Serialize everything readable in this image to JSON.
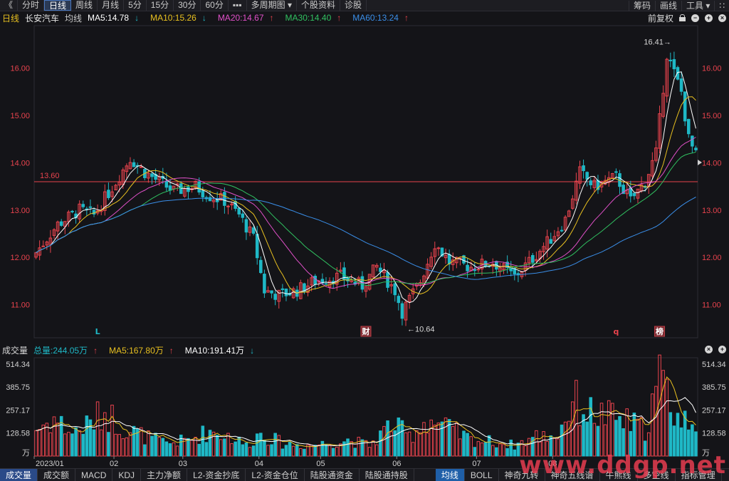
{
  "toolbar": {
    "collapse": "《",
    "items": [
      "分时",
      "日线",
      "周线",
      "月线",
      "5分",
      "15分",
      "30分",
      "60分",
      "▪▪▪",
      "多周期图",
      "▾",
      "个股资料",
      "诊股"
    ],
    "right": [
      "筹码",
      "画线",
      "工具",
      "▾",
      "∷"
    ]
  },
  "info": {
    "period": "日线",
    "stock": "长安汽车",
    "ma_label": "均线",
    "ma5": "MA5:14.78",
    "ma10": "MA10:15.26",
    "ma20": "MA20:14.67",
    "ma30": "MA30:14.40",
    "ma60": "MA60:13.24",
    "adjust": "前复权"
  },
  "volume": {
    "title": "成交量",
    "total": "总量:244.05万",
    "ma5": "MA5:167.80万",
    "ma10": "MA10:191.41万"
  },
  "annotations": {
    "high": "16.41→",
    "low": "←10.64",
    "hline": "13.60",
    "m_L": "L",
    "m_cai": "财",
    "m_q": "q",
    "m_bang": "榜"
  },
  "tabs": [
    "成交量",
    "成交额",
    "MACD",
    "KDJ",
    "主力净额",
    "L2-资金抄底",
    "L2-资金仓位",
    "陆股通资金",
    "陆股通持股",
    "均线",
    "BOLL",
    "神奇九转",
    "神奇五线谱",
    "牛熊线",
    "多空线",
    "指标管理"
  ],
  "watermark": "www.ddgp.net",
  "colors": {
    "up": "#e8434d",
    "down": "#1fb8c6",
    "ma5": "#ffffff",
    "ma10": "#e8c020",
    "ma20": "#e050c8",
    "ma30": "#30c060",
    "ma60": "#3a8ee8"
  },
  "chart_data": {
    "type": "candlestick",
    "price_axis": {
      "ticks": [
        11.0,
        12.0,
        13.0,
        14.0,
        15.0,
        16.0
      ],
      "ylim": [
        10.3,
        16.9
      ]
    },
    "volume_axis": {
      "ticks": [
        "514.34",
        "385.75",
        "257.17",
        "128.58",
        "万"
      ],
      "ylim": [
        0,
        550
      ]
    },
    "x_labels": [
      "2023/01",
      "02",
      "03",
      "04",
      "05",
      "06",
      "07",
      "08"
    ],
    "marked_high": 16.41,
    "marked_low": 10.64,
    "horizontal_line": 13.6,
    "ohlc_knots": [
      [
        0,
        12.1
      ],
      [
        6,
        12.7
      ],
      [
        12,
        13.0
      ],
      [
        16,
        12.9
      ],
      [
        22,
        13.6
      ],
      [
        26,
        14.1
      ],
      [
        30,
        13.8
      ],
      [
        34,
        13.6
      ],
      [
        38,
        13.4
      ],
      [
        44,
        13.5
      ],
      [
        48,
        13.3
      ],
      [
        52,
        13.2
      ],
      [
        56,
        12.9
      ],
      [
        60,
        12.4
      ],
      [
        63,
        11.3
      ],
      [
        67,
        11.2
      ],
      [
        72,
        11.3
      ],
      [
        77,
        11.5
      ],
      [
        84,
        11.6
      ],
      [
        90,
        11.4
      ],
      [
        94,
        11.8
      ],
      [
        99,
        11.3
      ],
      [
        101,
        10.85
      ],
      [
        106,
        11.5
      ],
      [
        110,
        12.3
      ],
      [
        114,
        11.9
      ],
      [
        120,
        11.8
      ],
      [
        126,
        11.9
      ],
      [
        132,
        11.6
      ],
      [
        136,
        11.9
      ],
      [
        142,
        12.4
      ],
      [
        146,
        12.8
      ],
      [
        150,
        13.8
      ],
      [
        154,
        13.5
      ],
      [
        160,
        13.7
      ],
      [
        164,
        13.2
      ],
      [
        168,
        13.6
      ],
      [
        171,
        14.2
      ],
      [
        174,
        16.3
      ],
      [
        178,
        15.5
      ],
      [
        180,
        14.5
      ],
      [
        182,
        14.15
      ]
    ],
    "volume_knots": [
      [
        0,
        150
      ],
      [
        5,
        210
      ],
      [
        10,
        130
      ],
      [
        15,
        180
      ],
      [
        19,
        250
      ],
      [
        24,
        160
      ],
      [
        30,
        110
      ],
      [
        36,
        70
      ],
      [
        42,
        90
      ],
      [
        48,
        140
      ],
      [
        53,
        115
      ],
      [
        58,
        60
      ],
      [
        62,
        130
      ],
      [
        68,
        70
      ],
      [
        74,
        60
      ],
      [
        80,
        70
      ],
      [
        86,
        90
      ],
      [
        92,
        60
      ],
      [
        98,
        180
      ],
      [
        103,
        110
      ],
      [
        108,
        210
      ],
      [
        114,
        150
      ],
      [
        120,
        90
      ],
      [
        126,
        80
      ],
      [
        132,
        60
      ],
      [
        138,
        110
      ],
      [
        144,
        120
      ],
      [
        148,
        310
      ],
      [
        153,
        240
      ],
      [
        158,
        220
      ],
      [
        163,
        190
      ],
      [
        168,
        150
      ],
      [
        172,
        430
      ],
      [
        175,
        310
      ],
      [
        178,
        180
      ],
      [
        182,
        244
      ]
    ],
    "ma_series": [
      {
        "name": "MA5",
        "period": 5
      },
      {
        "name": "MA10",
        "period": 10
      },
      {
        "name": "MA20",
        "period": 20
      },
      {
        "name": "MA30",
        "period": 30
      },
      {
        "name": "MA60",
        "period": 60
      }
    ]
  }
}
